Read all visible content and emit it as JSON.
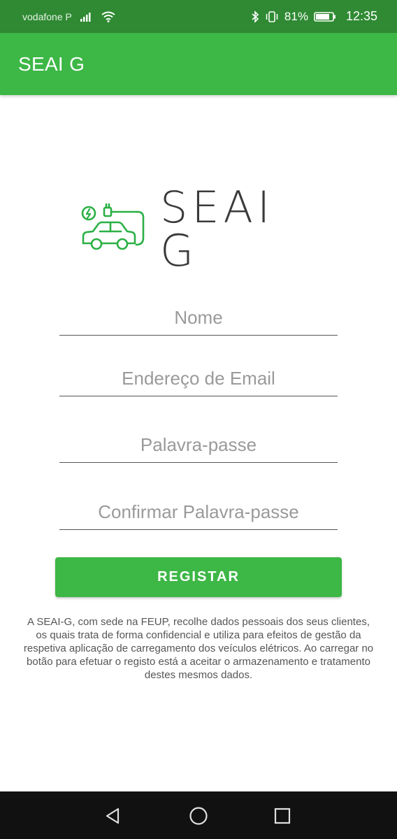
{
  "status_bar": {
    "carrier": "vodafone P",
    "battery_percent": "81%",
    "time": "12:35",
    "icons": [
      "signal-icon",
      "wifi-icon",
      "bluetooth-icon",
      "vibrate-icon",
      "battery-icon"
    ]
  },
  "app_bar": {
    "title": "SEAI G"
  },
  "logo": {
    "text": "SEAI G",
    "icon": "ev-charging-car-icon",
    "color": "#2bb045"
  },
  "form": {
    "name_placeholder": "Nome",
    "email_placeholder": "Endereço de Email",
    "password_placeholder": "Palavra-passe",
    "confirm_placeholder": "Confirmar Palavra-passe",
    "submit_label": "REGISTAR"
  },
  "disclaimer": "A SEAI-G, com sede na FEUP, recolhe dados pessoais dos seus clientes, os quais trata de forma confidencial e utiliza para efeitos de gestão da respetiva aplicação de carregamento dos veículos elétricos. Ao carregar no botão para efetuar o registo está a aceitar o armazenamento e tratamento destes mesmos dados.",
  "nav_bar": {
    "icons": [
      "back-icon",
      "home-icon",
      "recents-icon"
    ]
  },
  "colors": {
    "status_bar": "#2f8a33",
    "app_bar": "#3db746",
    "button": "#3db746",
    "nav_bar": "#111111"
  }
}
